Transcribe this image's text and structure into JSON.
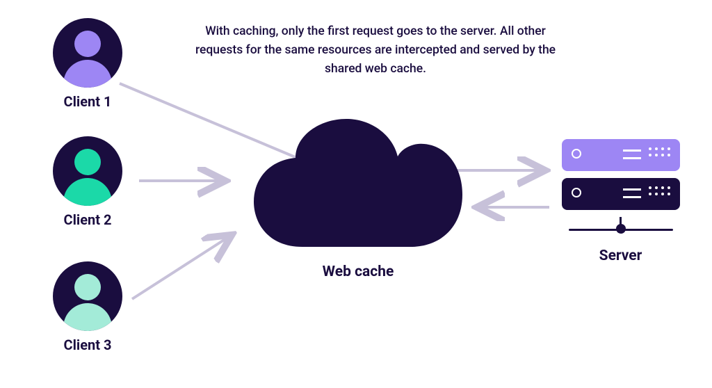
{
  "description": "With caching, only the first request goes to the server. All other requests for the same resources are intercepted and served by the shared web cache.",
  "clients": [
    {
      "label": "Client 1",
      "accent": "#9d86f4",
      "bg": "#1a0d3f"
    },
    {
      "label": "Client 2",
      "accent": "#1bd9a8",
      "bg": "#1a0d3f"
    },
    {
      "label": "Client 3",
      "accent": "#a3ebd8",
      "bg": "#1a0d3f"
    }
  ],
  "cache": {
    "label": "Web cache",
    "color": "#1a0d3f"
  },
  "server": {
    "label": "Server",
    "units": [
      {
        "color": "#9d86f4"
      },
      {
        "color": "#1a0d3f"
      }
    ]
  },
  "colors": {
    "arrow": "#c7c1d9",
    "text": "#1a0d3f"
  }
}
